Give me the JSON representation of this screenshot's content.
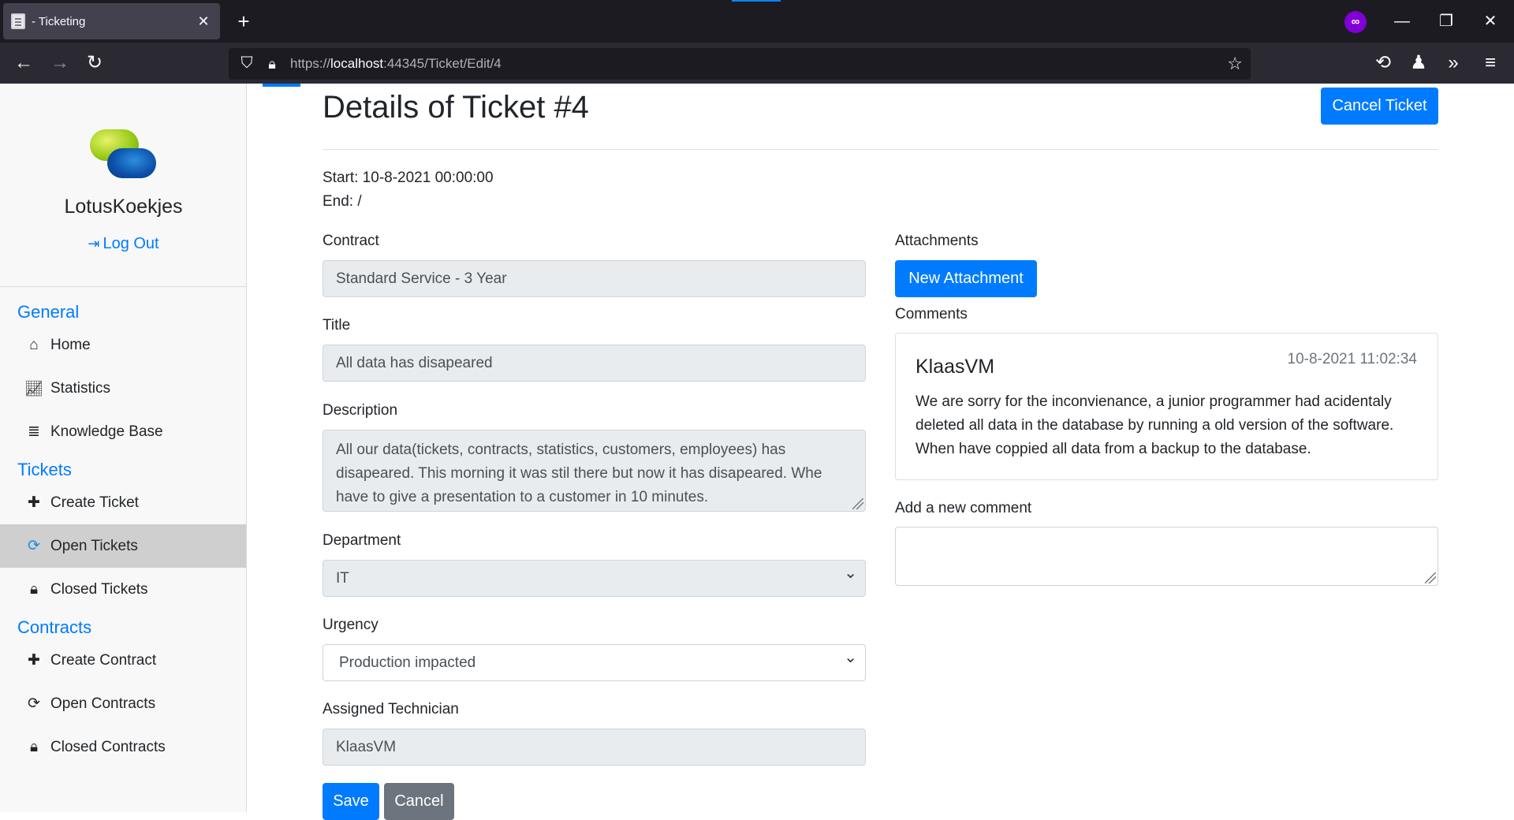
{
  "browser": {
    "tab_title": "- Ticketing",
    "tab_close": "✕",
    "new_tab": "+",
    "url_prefix": "https://",
    "url_host": "localhost",
    "url_path": ":44345/Ticket/Edit/4",
    "icons": {
      "back": "←",
      "forward": "→",
      "reload": "↻",
      "shield": "⛉",
      "lock": "🔒︎",
      "star": "☆",
      "history": "⟲",
      "extension": "♟",
      "overflow": "»",
      "menu": "≡",
      "private": "∞",
      "minimize": "—",
      "restore": "❐",
      "close": "✕"
    }
  },
  "sidebar": {
    "brand": "LotusKoekjes",
    "logout_icon": "⇥",
    "logout": "Log Out",
    "sections": {
      "general": "General",
      "tickets": "Tickets",
      "contracts": "Contracts"
    },
    "items": [
      {
        "icon": "⌂",
        "label": "Home"
      },
      {
        "icon": "📈︎",
        "label": "Statistics"
      },
      {
        "icon": "≣",
        "label": "Knowledge Base"
      },
      {
        "icon": "✚",
        "label": "Create Ticket"
      },
      {
        "icon": "⟳",
        "label": "Open Tickets"
      },
      {
        "icon": "🔒︎",
        "label": "Closed Tickets"
      },
      {
        "icon": "✚",
        "label": "Create Contract"
      },
      {
        "icon": "⟳",
        "label": "Open Contracts"
      },
      {
        "icon": "🔒︎",
        "label": "Closed Contracts"
      }
    ]
  },
  "main": {
    "title": "Details of Ticket #4",
    "cancel_ticket": "Cancel Ticket",
    "start": "Start: 10-8-2021 00:00:00",
    "end": "End: /",
    "contract_label": "Contract",
    "contract_value": "Standard Service - 3 Year",
    "title_label": "Title",
    "title_value": "All data has disapeared",
    "description_label": "Description",
    "description_value": "All our data(tickets, contracts, statistics, customers, employees) has disapeared. This morning it was stil there but now it has disapeared. Whe have to give a presentation to a customer in 10 minutes.",
    "department_label": "Department",
    "department_value": "IT",
    "urgency_label": "Urgency",
    "urgency_value": "Production impacted",
    "technician_label": "Assigned Technician",
    "technician_value": "KlaasVM",
    "save": "Save",
    "cancel": "Cancel"
  },
  "right": {
    "attachments_label": "Attachments",
    "new_attachment": "New Attachment",
    "comments_label": "Comments",
    "comment": {
      "author": "KlaasVM",
      "date": "10-8-2021 11:02:34",
      "text": "We are sorry for the inconvienance, a junior programmer had acidentaly deleted all data in the database by running a old version of the software. When have coppied all data from a backup to the database."
    },
    "add_comment_label": "Add a new comment",
    "add_comment_value": ""
  },
  "colors": {
    "primary": "#007bff",
    "secondary": "#6c757d",
    "sidebar_bg": "#f8f8f8",
    "active_item_bg": "#cfcfcf"
  }
}
